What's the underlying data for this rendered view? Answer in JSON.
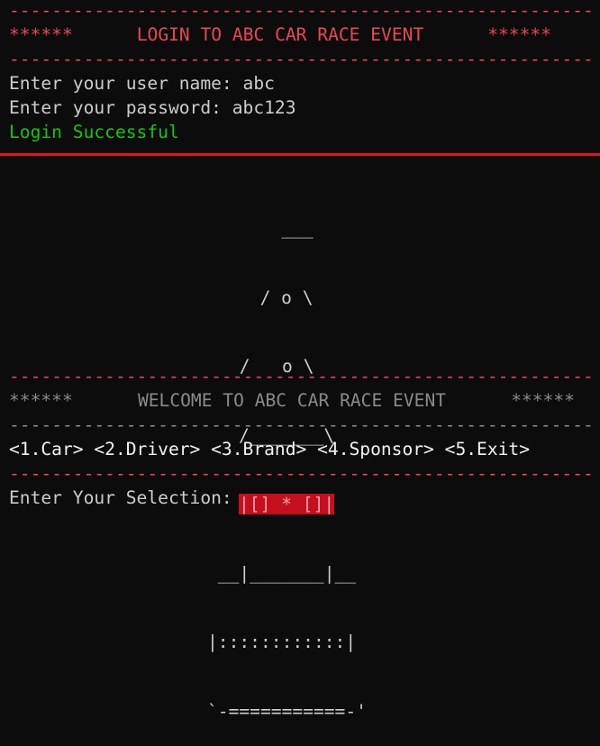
{
  "login": {
    "rule": "--------------------------------------------------------",
    "stars_left": "******",
    "title": "LOGIN TO ABC CAR RACE EVENT",
    "stars_right": "******",
    "username_prompt": "Enter your user name: abc",
    "password_prompt": "Enter your password: abc123",
    "status": "Login Successful"
  },
  "art": {
    "line1": "   ___",
    "line2": "  / o \\",
    "line3": " /   o \\",
    "line4": "/_______\\",
    "line5_hl": "|[] * []|",
    "line6": " __|_______|__",
    "line7": "|::::::::::::|",
    "line8": "`-===========-'"
  },
  "welcome": {
    "rule": "--------------------------------------------------------",
    "stars_left": "******",
    "title": "WELCOME TO ABC CAR RACE EVENT",
    "stars_right": "******",
    "menu": "<1.Car> <2.Driver> <3.Brand> <4.Sponsor> <5.Exit>",
    "prompt": "Enter Your Selection:"
  },
  "colors": {
    "background": "#0c0c0c",
    "red_text": "#e74856",
    "green_text": "#16c60c",
    "divider": "#e81123",
    "highlight": "#c50f1f"
  }
}
